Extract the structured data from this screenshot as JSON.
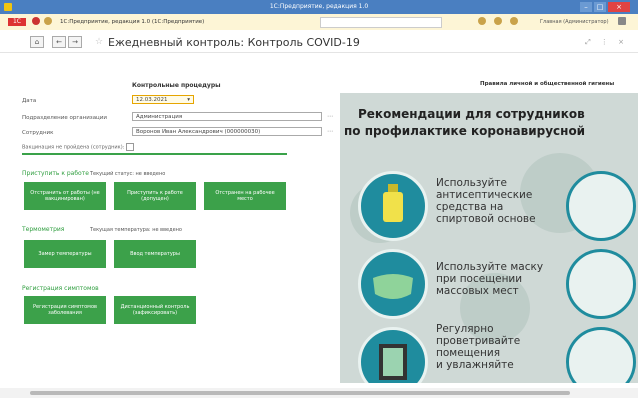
{
  "window": {
    "title": "1С:Предприятие, редакция 1.0"
  },
  "menubar": {
    "app_text": "1С:Предприятие, редакция 1.0 (1С:Предприятие)",
    "user_text": "Главная (Администратор)"
  },
  "page": {
    "title": "Ежедневный контроль: Контроль COVID-19"
  },
  "form": {
    "section_title": "Контрольные процедуры",
    "date_label": "Дата",
    "date_value": "12.03.2021",
    "division_label": "Подразделение организации",
    "division_value": "Администрация",
    "employee_label": "Сотрудник",
    "employee_value": "Воронов Иван Александрович (000000030)",
    "vaccination_label": "Вакцинация не пройдена (сотрудник):"
  },
  "groups": {
    "work_label": "Приступить к работе",
    "work_note": "Текущий статус: не введено",
    "work_buttons": [
      "Отстранить от работы (не вакцинирован)",
      "Приступить к работе (допущен)",
      "Отстранен на рабочее место"
    ],
    "temp_label": "Термометрия",
    "temp_note": "Текущая температура: не введено",
    "temp_buttons": [
      "Замер температуры",
      "Ввод температуры"
    ],
    "symptoms_label": "Регистрация симптомов",
    "symptoms_buttons": [
      "Регистрация симптомов заболевания",
      "Дистанционный контроль (зафиксировать)"
    ]
  },
  "poster": {
    "header": "Правила личной и общественной гигиены",
    "title_line1": "Рекомендации для сотрудников",
    "title_line2": "по профилактике коронавирусной",
    "items": [
      [
        "Используйте",
        "антисептические",
        "средства на",
        "спиртовой основе"
      ],
      [
        "Используйте маску",
        "при посещении",
        "массовых мест"
      ],
      [
        "Регулярно",
        "проветривайте",
        "помещения",
        "и увлажняйте"
      ]
    ]
  }
}
